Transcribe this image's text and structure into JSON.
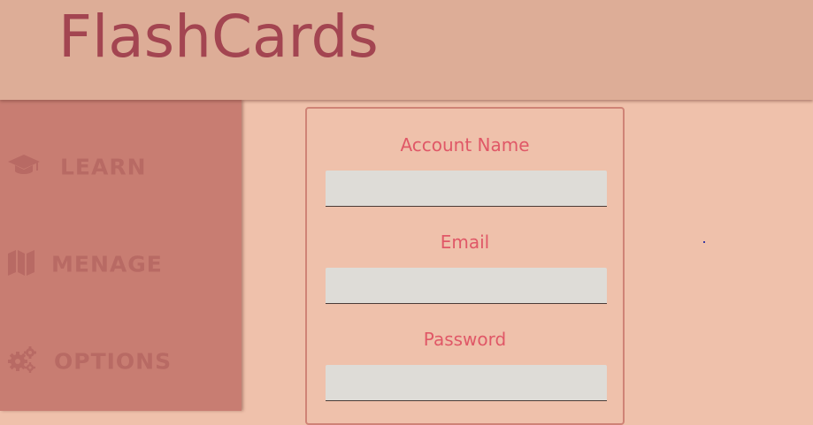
{
  "header": {
    "title": "FlashCards"
  },
  "sidebar": {
    "items": [
      {
        "label": "LEARN",
        "icon": "graduation-cap-icon"
      },
      {
        "label": "MENAGE",
        "icon": "map-icon"
      },
      {
        "label": "OPTIONS",
        "icon": "gears-icon"
      }
    ]
  },
  "form": {
    "fields": [
      {
        "label": "Account Name",
        "value": "",
        "placeholder": ""
      },
      {
        "label": "Email",
        "value": "",
        "placeholder": ""
      },
      {
        "label": "Password",
        "value": "",
        "placeholder": ""
      }
    ]
  },
  "colors": {
    "header_bg": "#ddad97",
    "title": "#a34551",
    "sidebar_bg": "#c87d72",
    "sidebar_text": "#b86a64",
    "page_bg": "#efc1ab",
    "field_label": "#e05867",
    "input_bg": "#dedcd7"
  }
}
